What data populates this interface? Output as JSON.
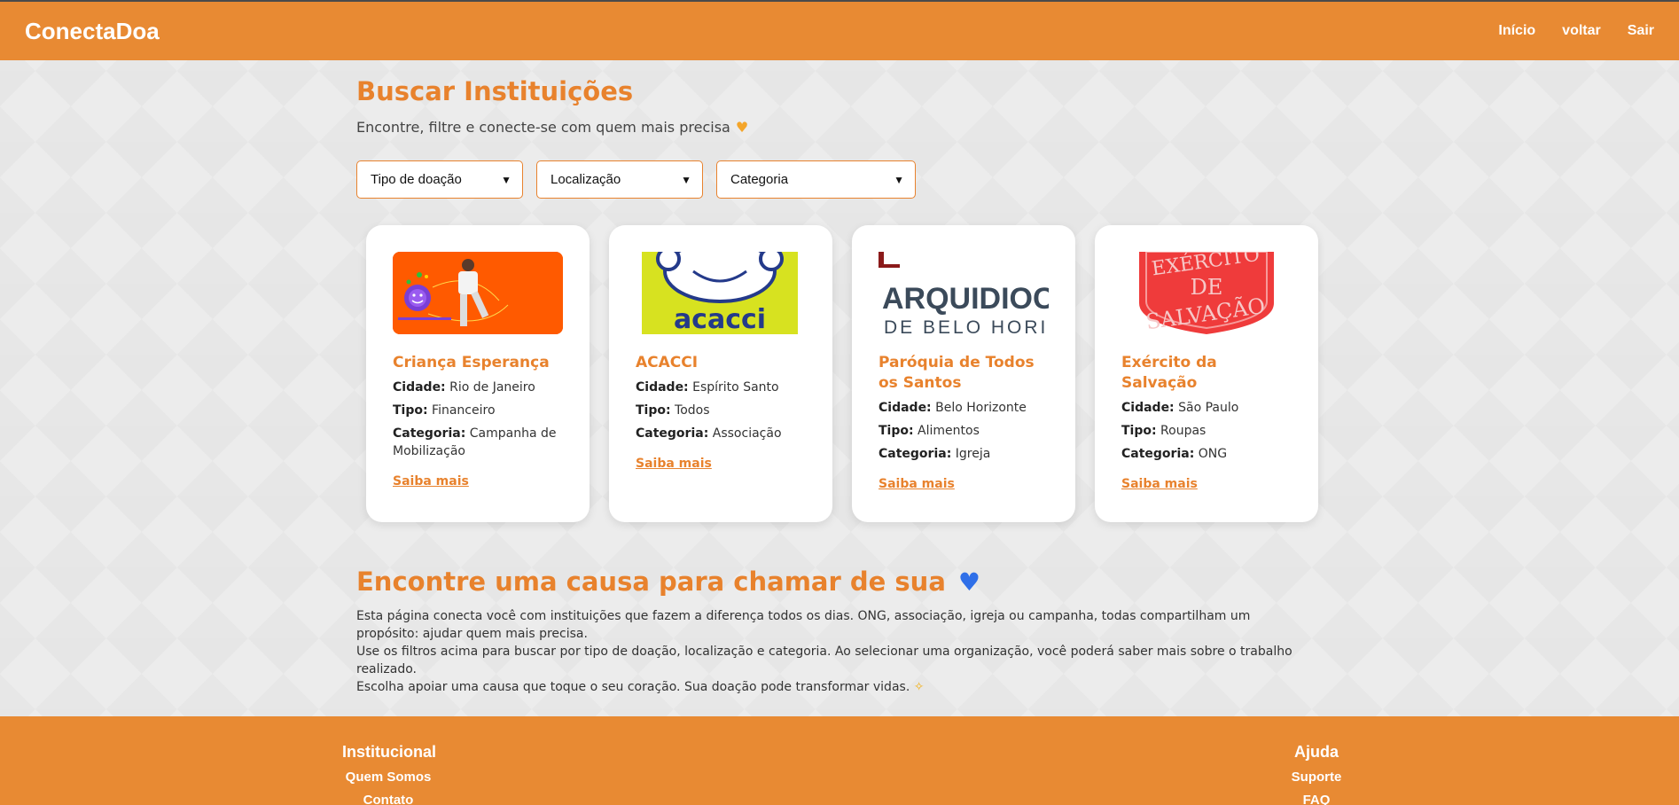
{
  "header": {
    "brand": "ConectaDoa",
    "nav": [
      "Início",
      "voltar",
      "Sair"
    ]
  },
  "search": {
    "title": "Buscar Instituições",
    "subtitle": "Encontre, filtre e conecte-se com quem mais precisa",
    "filters": [
      "Tipo de doação",
      "Localização",
      "Categoria"
    ]
  },
  "labels": {
    "cidade": "Cidade:",
    "tipo": "Tipo:",
    "categoria": "Categoria:",
    "saiba_mais": "Saiba mais"
  },
  "cards": [
    {
      "name": "Criança Esperança",
      "cidade": "Rio de Janeiro",
      "tipo": "Financeiro",
      "categoria": "Campanha de Mobilização"
    },
    {
      "name": "ACACCI",
      "cidade": "Espírito Santo",
      "tipo": "Todos",
      "categoria": "Associação",
      "logo_text": "acacci"
    },
    {
      "name": "Paróquia de Todos os Santos",
      "cidade": "Belo Horizonte",
      "tipo": "Alimentos",
      "categoria": "Igreja",
      "logo_text_1": "ARQUIDIOCE",
      "logo_text_2": "DE BELO HORIZO"
    },
    {
      "name": "Exército da Salvação",
      "cidade": "São Paulo",
      "tipo": "Roupas",
      "categoria": "ONG",
      "logo_text_1": "EXÉRCITO",
      "logo_text_2": "DE",
      "logo_text_3": "SALVAÇÃO"
    }
  ],
  "cause": {
    "title": "Encontre uma causa para chamar de sua",
    "p1": "Esta página conecta você com instituições que fazem a diferença todos os dias. ONG, associação, igreja ou campanha, todas compartilham um propósito: ajudar quem mais precisa.",
    "p2": "Use os filtros acima para buscar por tipo de doação, localização e categoria. Ao selecionar uma organização, você poderá saber mais sobre o trabalho realizado.",
    "p3": "Escolha apoiar uma causa que toque o seu coração. Sua doação pode transformar vidas."
  },
  "footer": {
    "col1_title": "Institucional",
    "col1_links": [
      "Quem Somos",
      "Contato"
    ],
    "col2_title": "Ajuda",
    "col2_links": [
      "Suporte",
      "FAQ"
    ]
  },
  "colors": {
    "accent": "#e88a33",
    "title": "#e8822d"
  }
}
